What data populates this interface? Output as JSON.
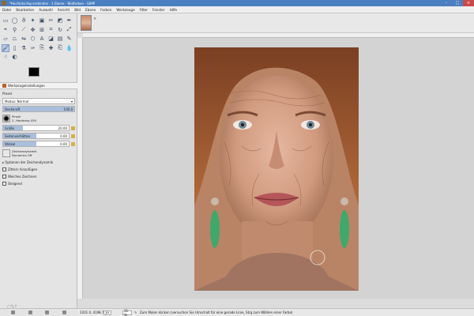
{
  "window": {
    "title": "*Hochkitschig-verbinden - 1 Ebene - Bildfarben - GIMP",
    "controls": [
      "–",
      "□",
      "×"
    ]
  },
  "menu": [
    "Datei",
    "Bearbeiten",
    "Auswahl",
    "Ansicht",
    "Bild",
    "Ebene",
    "Farben",
    "Werkzeuge",
    "Filter",
    "Fenster",
    "Hilfe"
  ],
  "toolbox": {
    "tools": [
      "rect-select",
      "ellipse-select",
      "free-select",
      "fuzzy-select",
      "color-select",
      "scissors",
      "foreground-select",
      "paths",
      "color-picker",
      "zoom",
      "measure",
      "move",
      "align",
      "crop",
      "rotate",
      "scale",
      "shear",
      "perspective",
      "flip",
      "cage",
      "text",
      "bucket-fill",
      "blend",
      "pencil",
      "paintbrush",
      "eraser",
      "airbrush",
      "ink",
      "clone",
      "heal",
      "perspective-clone",
      "blur",
      "smudge",
      "dodge-burn"
    ],
    "active_tool": "paintbrush"
  },
  "tool_options": {
    "tab_label": "Werkzeugeinstellungen",
    "title": "Pinsel",
    "mode_label": "Modus: Normal",
    "opacity_label": "Deckkraft",
    "opacity_value": "100.0",
    "brush_label": "Pinsel",
    "brush_name": "2. Hardness 050",
    "size_label": "Größe",
    "size_value": "20.00",
    "size_fill": 0.3,
    "ratio_label": "Seitenverhältnis",
    "ratio_value": "0.00",
    "ratio_fill": 0.5,
    "angle_label": "Winkel",
    "angle_value": "0.00",
    "angle_fill": 0.5,
    "dynamics_label": "Zeichendynamik",
    "dynamics_value": "Dynamics Off",
    "checks": [
      "Optionen der Zeichendynamik",
      "Zittern hinzufügen",
      "Weiches Zeichnen",
      "Steigend"
    ]
  },
  "status": {
    "coords": "2201.0, 4198.7",
    "unit": "px",
    "zoom": "11 %",
    "message": "Zum Malen klicken (versuchen Sie Umschalt für eine gerade Linie, Strg zum Wählen einer Farbe)"
  },
  "colors": {
    "accent": "#4a7fc1",
    "foreground": "#000000",
    "background": "#ffffff"
  }
}
